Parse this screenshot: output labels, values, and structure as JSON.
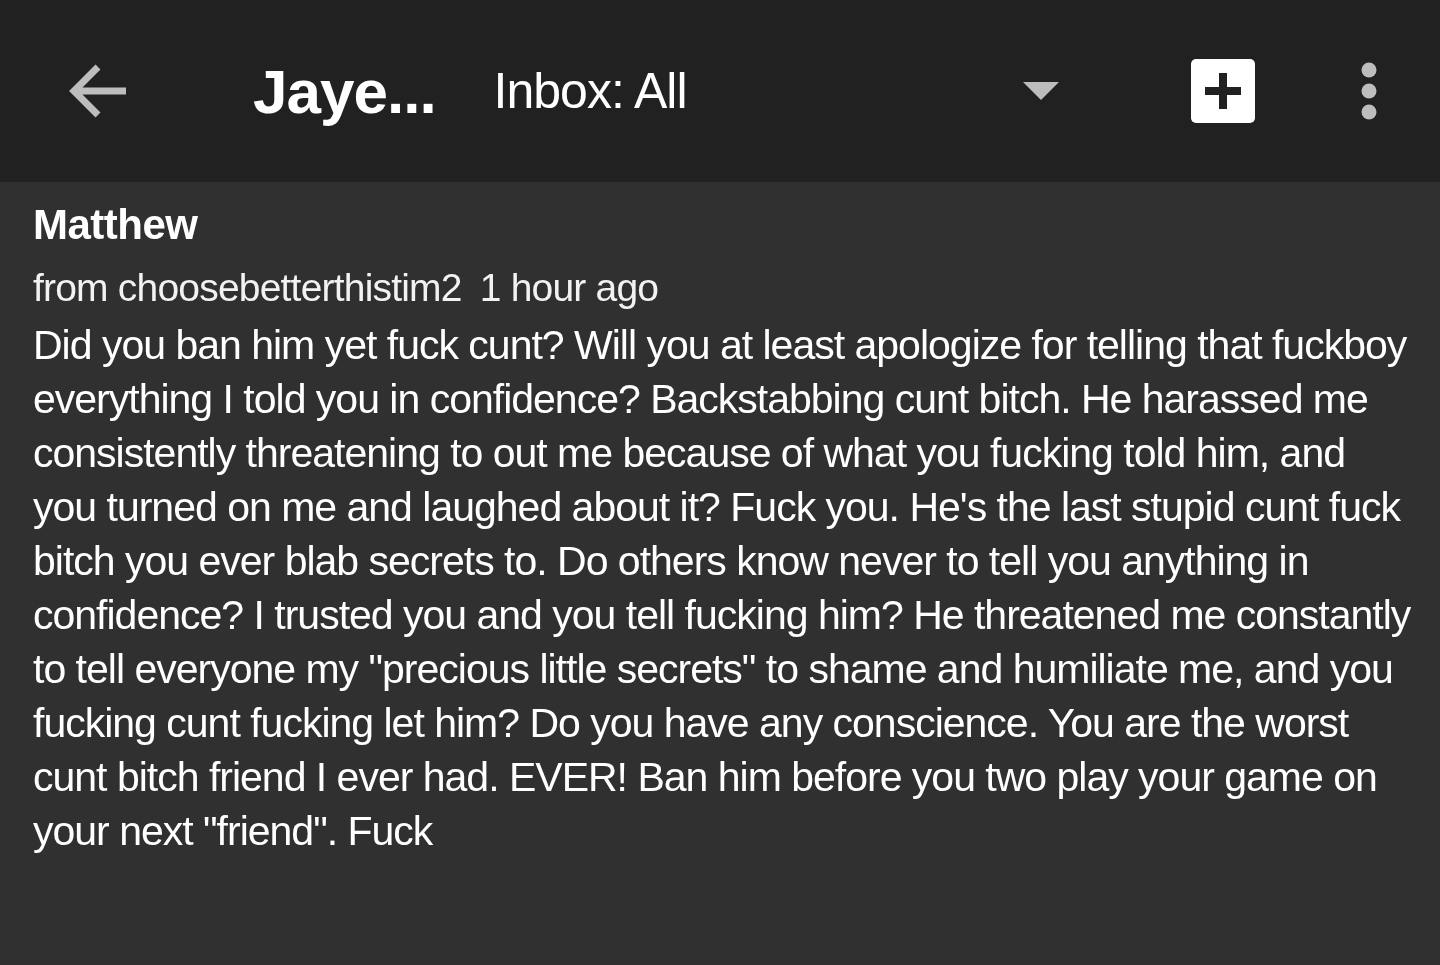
{
  "toolbar": {
    "title": "Jaye...",
    "inbox_filter": "Inbox: All"
  },
  "message": {
    "sender": "Matthew",
    "from": "from choosebetterthistim2",
    "time": "1 hour ago",
    "body": "Did you ban him yet fuck cunt? Will you at least apologize for telling that fuckboy everything I told you in confidence? Backstabbing cunt bitch. He harassed me consistently threatening to out me because of what you fucking told him, and you turned on me and laughed about it? Fuck you. He's the last stupid cunt fuck bitch you ever blab secrets to. Do others know never to tell you anything in confidence? I trusted you and you tell fucking him? He threatened me constantly to tell everyone my \"precious little secrets\" to shame and humiliate me, and you fucking cunt fucking let him? Do you have any conscience. You are the worst cunt bitch friend I ever had. EVER! Ban him before you two play your game on your next \"friend\". Fuck"
  }
}
